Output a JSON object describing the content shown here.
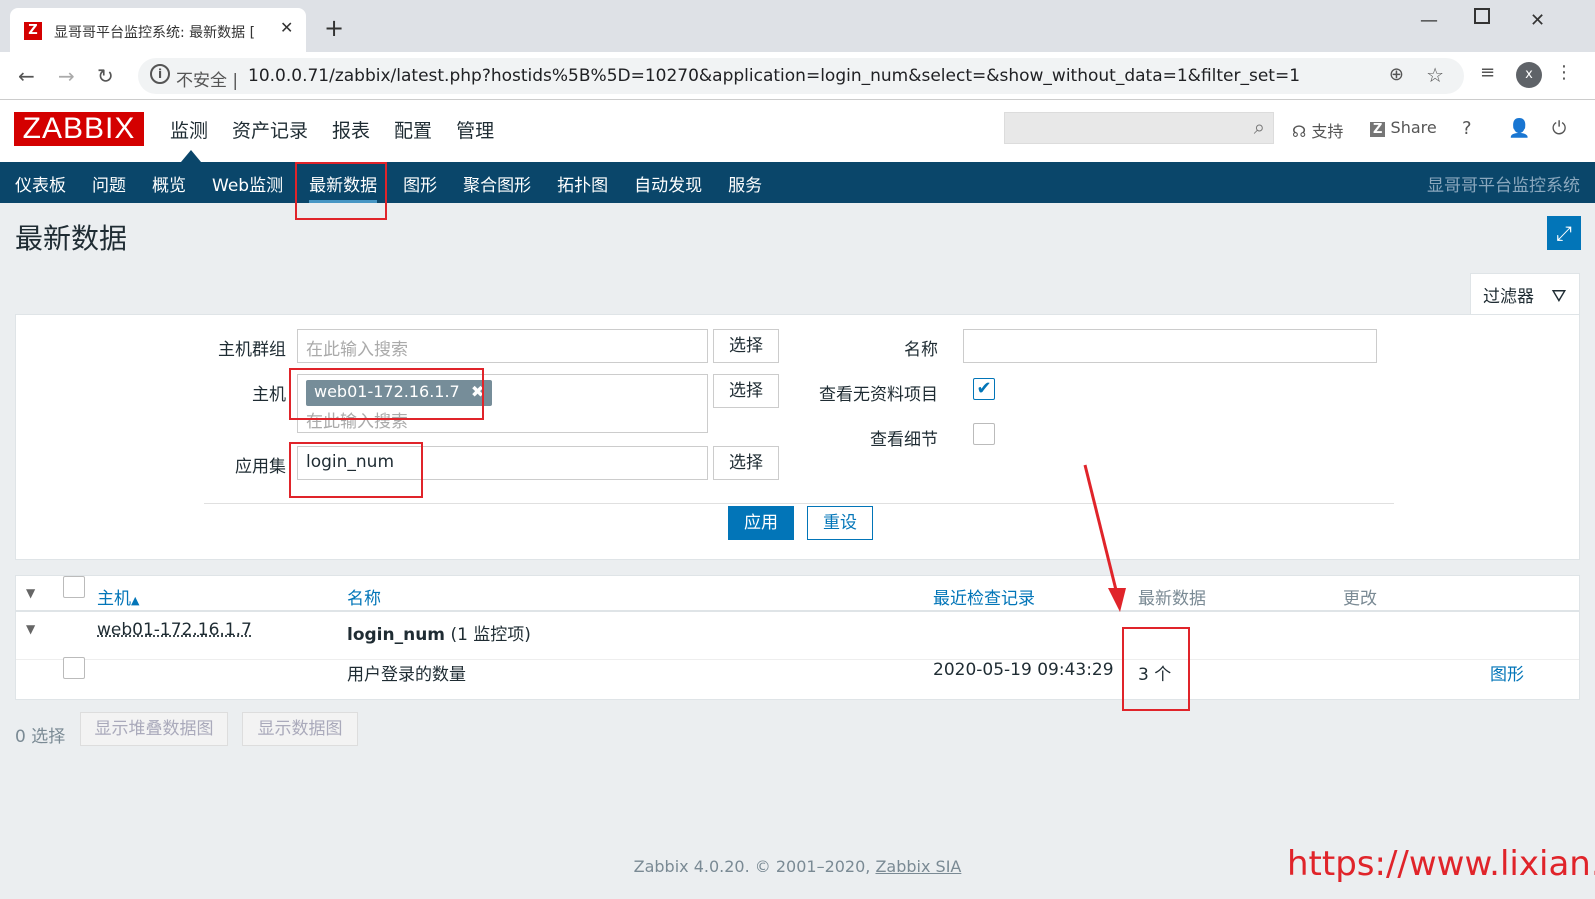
{
  "browser": {
    "tab_title": "显哥哥平台监控系统: 最新数据 [",
    "insecure_label": "不安全 |",
    "url": "10.0.0.71/zabbix/latest.php?hostids%5B%5D=10270&application=login_num&select=&show_without_data=1&filter_set=1",
    "avatar_letter": "x"
  },
  "header": {
    "logo": "ZABBIX",
    "menu": [
      "监测",
      "资产记录",
      "报表",
      "配置",
      "管理"
    ],
    "support": "支持",
    "share": "Share",
    "help": "?"
  },
  "subnav": {
    "items": [
      "仪表板",
      "问题",
      "概览",
      "Web监测",
      "最新数据",
      "图形",
      "聚合图形",
      "拓扑图",
      "自动发现",
      "服务"
    ],
    "active": "最新数据",
    "brand": "显哥哥平台监控系统"
  },
  "page": {
    "title": "最新数据"
  },
  "filter": {
    "tab_label": "过滤器",
    "host_group_label": "主机群组",
    "host_group_placeholder": "在此输入搜索",
    "host_label": "主机",
    "host_chip": "web01-172.16.1.7",
    "host_placeholder": "在此输入搜索",
    "application_label": "应用集",
    "application_value": "login_num",
    "select_button": "选择",
    "name_label": "名称",
    "name_value": "",
    "show_without_data_label": "查看无资料项目",
    "show_without_data": true,
    "show_details_label": "查看细节",
    "show_details": false,
    "apply_button": "应用",
    "reset_button": "重设"
  },
  "table": {
    "headers": {
      "host": "主机",
      "name": "名称",
      "last_check": "最近检查记录",
      "last_value": "最新数据",
      "change": "更改"
    },
    "sort_indicator": "▲",
    "group_row": {
      "host": "web01-172.16.1.7",
      "app": "login_num",
      "app_count": "(1 监控项)"
    },
    "rows": [
      {
        "name": "用户登录的数量",
        "last_check": "2020-05-19 09:43:29",
        "last_value": "3 个",
        "change": "",
        "action": "图形"
      }
    ]
  },
  "bottom": {
    "selected": "0 选择",
    "stacked_graph_button": "显示堆叠数据图",
    "graph_button": "显示数据图"
  },
  "footer": {
    "text": "Zabbix 4.0.20. © 2001–2020,",
    "link": "Zabbix SIA"
  },
  "watermark": "https://www.lixian.fun",
  "colors": {
    "brand_red": "#d40000",
    "nav_dark": "#0a466a",
    "accent_blue": "#0275b8",
    "annotation_red": "#e0242a"
  }
}
